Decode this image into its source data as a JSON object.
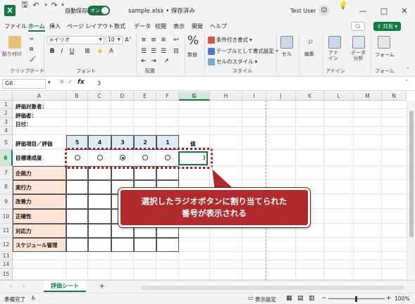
{
  "titlebar": {
    "autosave_label": "自動保存",
    "autosave_state": "オン",
    "file_title": "sample.xlsx • 保存済み",
    "user_name": "Test User"
  },
  "menu": {
    "tabs": [
      "ファイル",
      "ホーム",
      "挿入",
      "ページ レイアウト",
      "数式",
      "データ",
      "校閲",
      "表示",
      "開発",
      "ヘルプ"
    ],
    "active_tab": "ホーム",
    "comment_label": "",
    "share_label": "共有"
  },
  "ribbon": {
    "paste_label": "貼り付け",
    "clipboard_group": "クリップボード",
    "font_name": "メイリオ",
    "font_size": "10",
    "font_group": "フォント",
    "align_group": "配置",
    "number_label": "数値",
    "number_symbol": "%",
    "cond_format": "条件付き書式",
    "table_format": "テーブルとして書式設定",
    "cell_style": "セルのスタイル",
    "style_group": "スタイル",
    "cell_label": "セル",
    "edit_label": "編集",
    "addin_label": "アド\nイン",
    "addin_group": "アドイン",
    "data_analysis_label": "データ\n分析",
    "form_label": "フォーム",
    "form_group": "フォーム",
    "bold": "B",
    "italic": "I",
    "underline": "U"
  },
  "formula": {
    "name_box": "G6",
    "fx": "fx",
    "value": "3"
  },
  "columns": [
    "A",
    "B",
    "C",
    "D",
    "E",
    "F",
    "G",
    "H",
    "I",
    "J",
    "K",
    "L",
    "M",
    "N"
  ],
  "rows": [
    "1",
    "2",
    "3",
    "4",
    "5",
    "6",
    "7",
    "8",
    "9",
    "10",
    "11",
    "12",
    "13",
    "14",
    "15"
  ],
  "sheet": {
    "a1": "評価対象者：",
    "a2": "評価者：",
    "a3": "日付：",
    "a5": "評価項目／評価",
    "scores": [
      "5",
      "4",
      "3",
      "2",
      "1"
    ],
    "g5": "値",
    "items": [
      "目標達成度",
      "企画力",
      "実行力",
      "改善力",
      "正確性",
      "対応力",
      "スケジュール管理"
    ],
    "g6": "3",
    "selected_radio": 3
  },
  "callout": {
    "line1": "選択したラジオボタンに割り当てられた",
    "line2": "番号が表示される"
  },
  "sheet_tab": "評価シート",
  "status": {
    "ready": "準備完了",
    "display_settings": "表示設定",
    "zoom": "100%"
  }
}
